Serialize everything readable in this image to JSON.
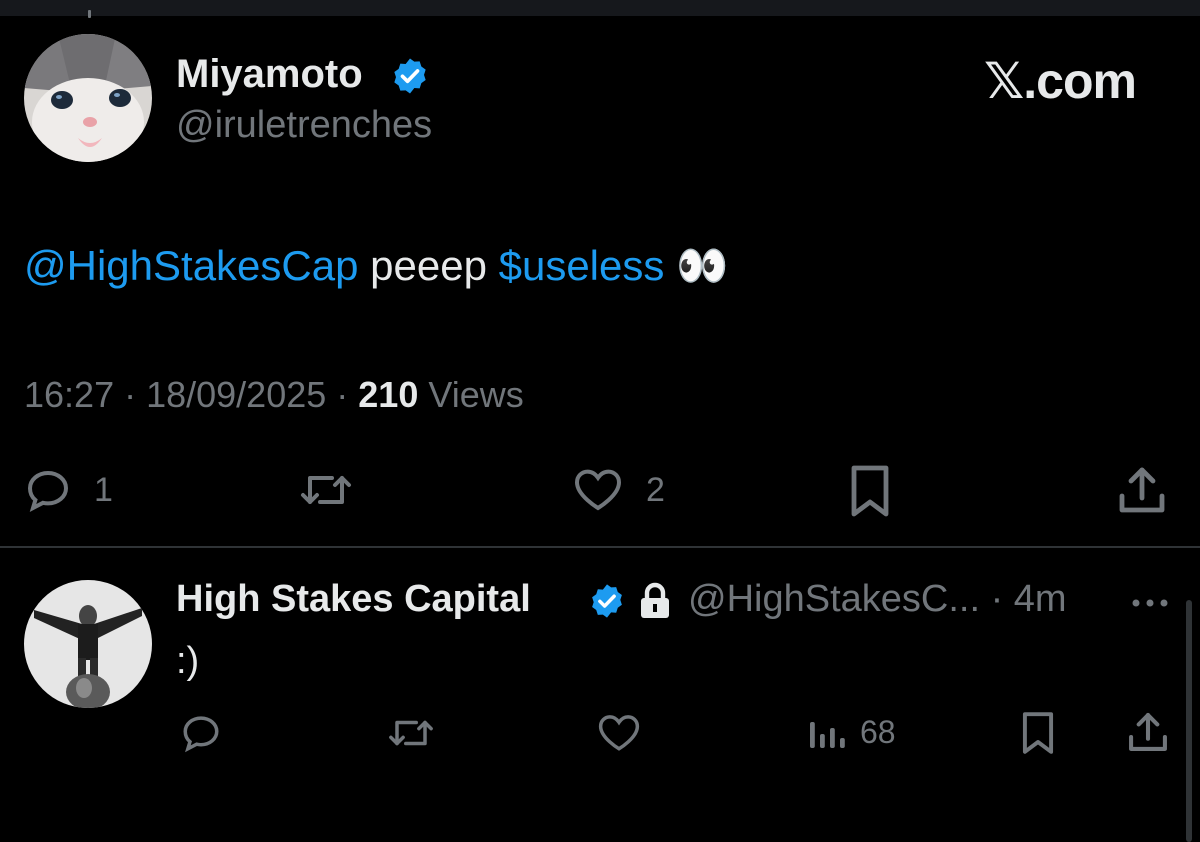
{
  "brand": "𝕏.com",
  "tweet": {
    "author_name": "Miyamoto",
    "author_handle": "@iruletrenches",
    "text_mention": "@HighStakesCap",
    "text_middle": " peeep ",
    "text_cashtag": "$useless",
    "text_emoji": " 👀",
    "time": "16:27",
    "sep1": " · ",
    "date": "18/09/2025",
    "sep2": " · ",
    "views_count": "210",
    "views_label": " Views",
    "replies": "1",
    "likes": "2"
  },
  "reply": {
    "author_name": "High Stakes Capital",
    "author_handle": "@HighStakesC...",
    "age": " · 4m",
    "text": ":)",
    "views": "68"
  },
  "icons": {
    "verified": "verified-badge-icon",
    "lock": "lock-icon",
    "reply": "reply-icon",
    "retweet": "retweet-icon",
    "like": "heart-icon",
    "bookmark": "bookmark-icon",
    "share": "share-icon",
    "views": "views-icon",
    "more": "more-icon"
  },
  "colors": {
    "accent": "#1d9bf0",
    "muted": "#71767b",
    "text": "#e7e9ea",
    "background": "#000000"
  }
}
